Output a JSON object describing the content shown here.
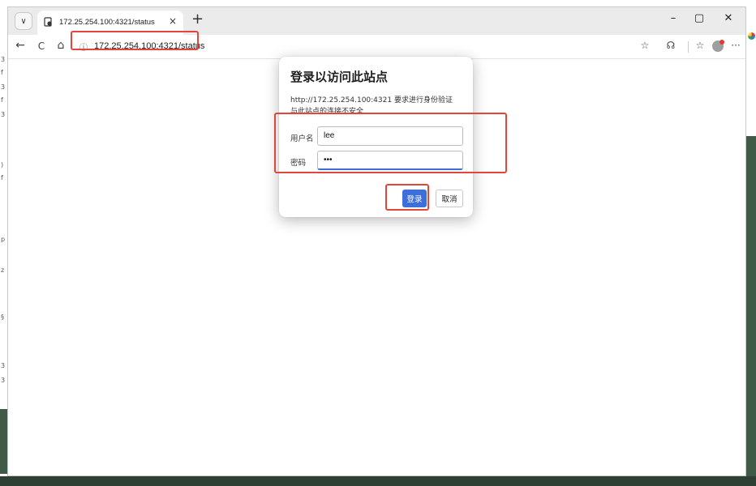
{
  "colors": {
    "accent": "#3c6fd9",
    "annotation": "#e0473a"
  },
  "tab": {
    "title": "172.25.254.100:4321/status",
    "close": "×",
    "new_tab": "+",
    "dropdown": "∨"
  },
  "window_controls": {
    "minimize": "–",
    "maximize": "▢",
    "close": "✕"
  },
  "toolbar": {
    "back": "←",
    "refresh": "C",
    "home": "⌂",
    "info_icon": "ⓘ",
    "url": "172.25.254.100:4321/status",
    "star": "☆",
    "extensions": "☊",
    "favorites": "☆",
    "more": "···"
  },
  "dialog": {
    "title": "登录以访问此站点",
    "line1": "http://172.25.254.100:4321 要求进行身份验证",
    "line2": "与此站点的连接不安全",
    "username_label": "用户名",
    "username_value": "lee",
    "password_label": "密码",
    "password_value": "•••",
    "login_button": "登录",
    "cancel_button": "取消"
  }
}
